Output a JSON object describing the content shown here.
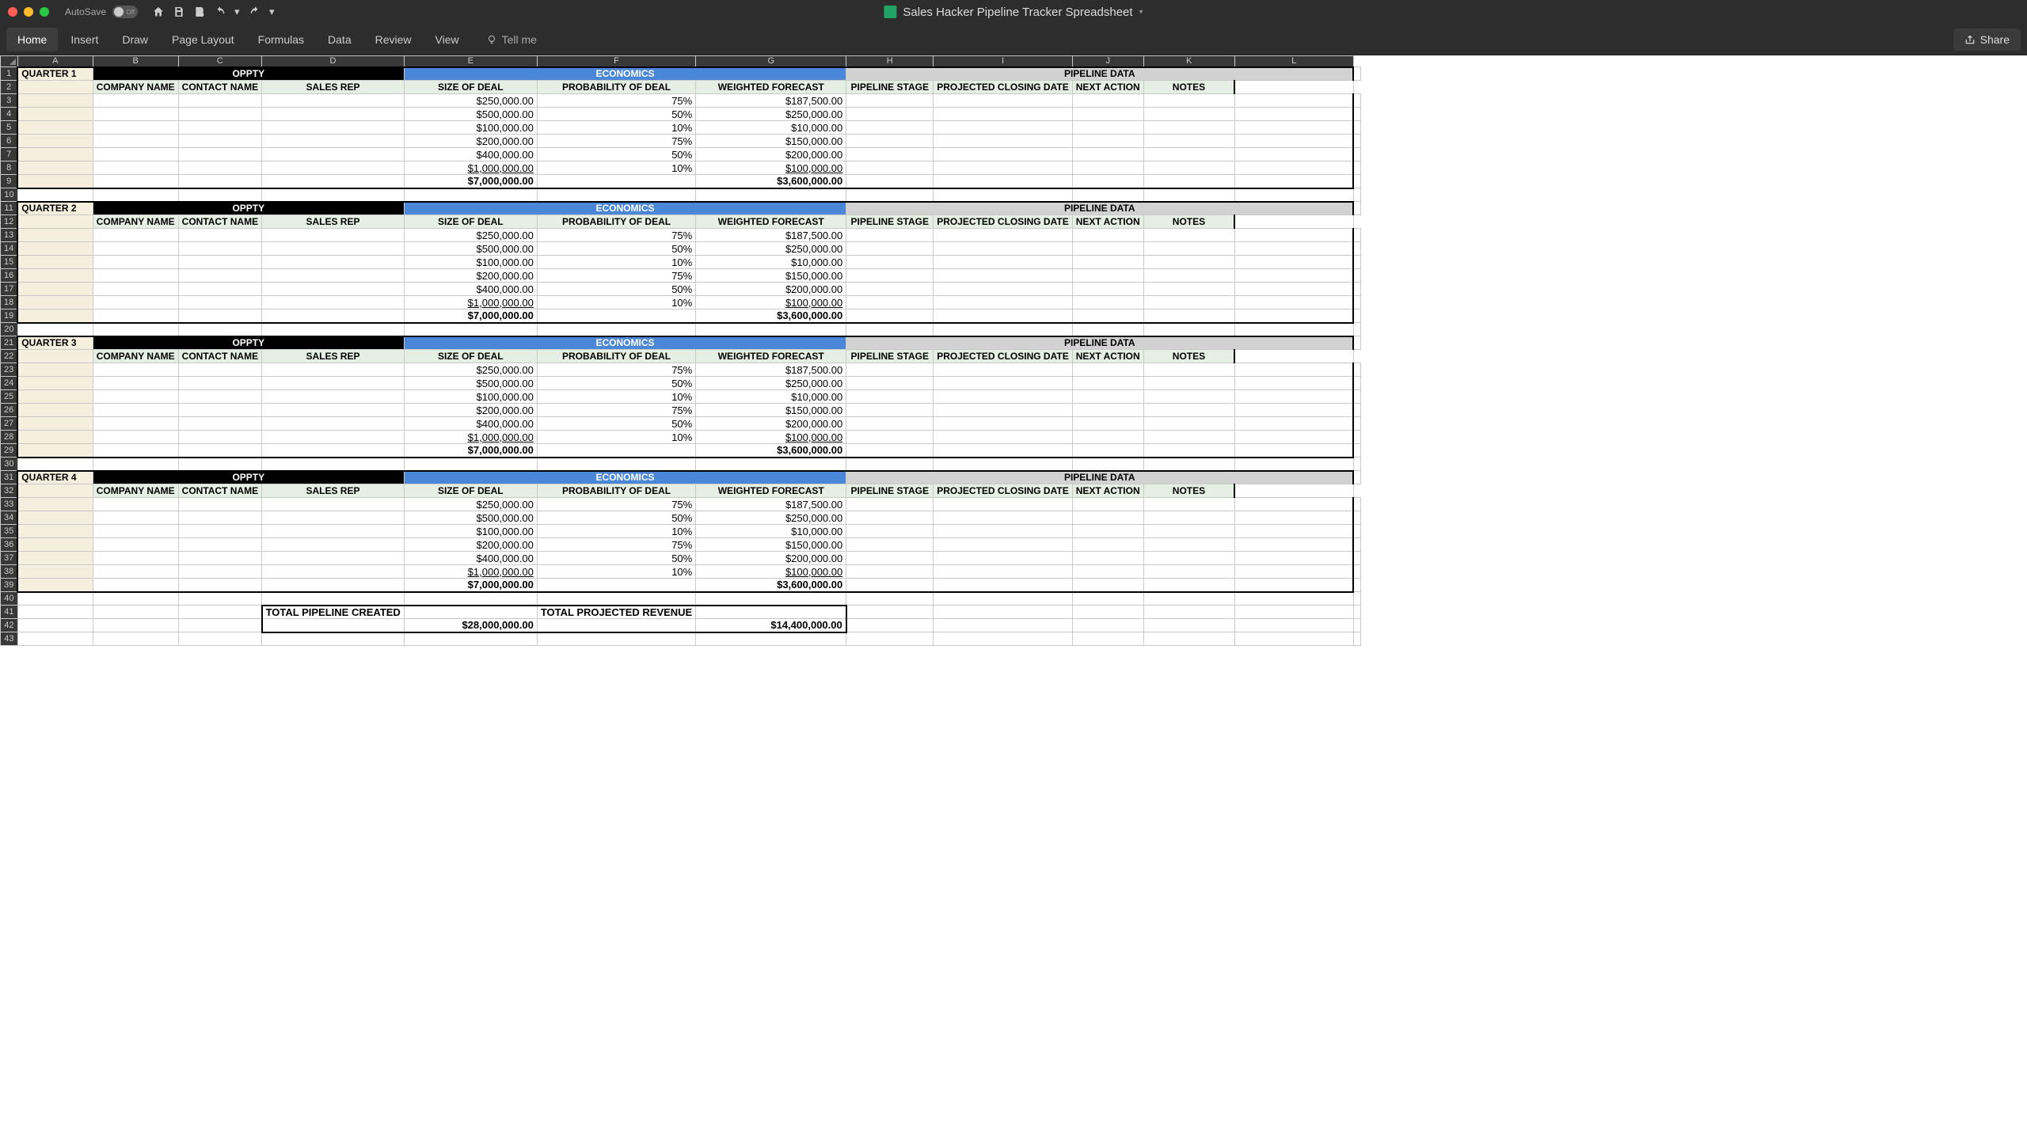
{
  "window": {
    "autosave_label": "AutoSave",
    "autosave_state": "Off",
    "title": "Sales Hacker Pipeline Tracker Spreadsheet"
  },
  "ribbon": {
    "tabs": [
      "Home",
      "Insert",
      "Draw",
      "Page Layout",
      "Formulas",
      "Data",
      "Review",
      "View"
    ],
    "active": 0,
    "tell_me": "Tell me",
    "share": "Share"
  },
  "columns": [
    "A",
    "B",
    "C",
    "D",
    "E",
    "F",
    "G",
    "H",
    "I",
    "J",
    "K",
    "L"
  ],
  "section_headers": {
    "oppty": "OPPTY",
    "economics": "ECONOMICS",
    "pipeline_data": "PIPELINE DATA"
  },
  "sub_headers": [
    "COMPANY NAME",
    "CONTACT NAME",
    "SALES REP",
    "SIZE OF DEAL",
    "PROBABILITY OF DEAL",
    "WEIGHTED FORECAST",
    "PIPELINE STAGE",
    "PROJECTED CLOSING DATE",
    "NEXT ACTION",
    "NOTES"
  ],
  "quarters": [
    {
      "title": "QUARTER 1"
    },
    {
      "title": "QUARTER 2"
    },
    {
      "title": "QUARTER 3"
    },
    {
      "title": "QUARTER 4"
    }
  ],
  "deal_rows": [
    {
      "size": "$250,000.00",
      "prob": "75%",
      "wf": "$187,500.00"
    },
    {
      "size": "$500,000.00",
      "prob": "50%",
      "wf": "$250,000.00"
    },
    {
      "size": "$100,000.00",
      "prob": "10%",
      "wf": "$10,000.00"
    },
    {
      "size": "$200,000.00",
      "prob": "75%",
      "wf": "$150,000.00"
    },
    {
      "size": "$400,000.00",
      "prob": "50%",
      "wf": "$200,000.00"
    },
    {
      "size": "$1,000,000.00",
      "prob": "10%",
      "wf": "$100,000.00",
      "u": true
    }
  ],
  "quarter_total": {
    "size": "$7,000,000.00",
    "wf": "$3,600,000.00"
  },
  "totals": {
    "pipeline_label": "TOTAL PIPELINE CREATED",
    "pipeline_value": "$28,000,000.00",
    "revenue_label": "TOTAL PROJECTED REVENUE",
    "revenue_value": "$14,400,000.00"
  },
  "row_count": 43
}
